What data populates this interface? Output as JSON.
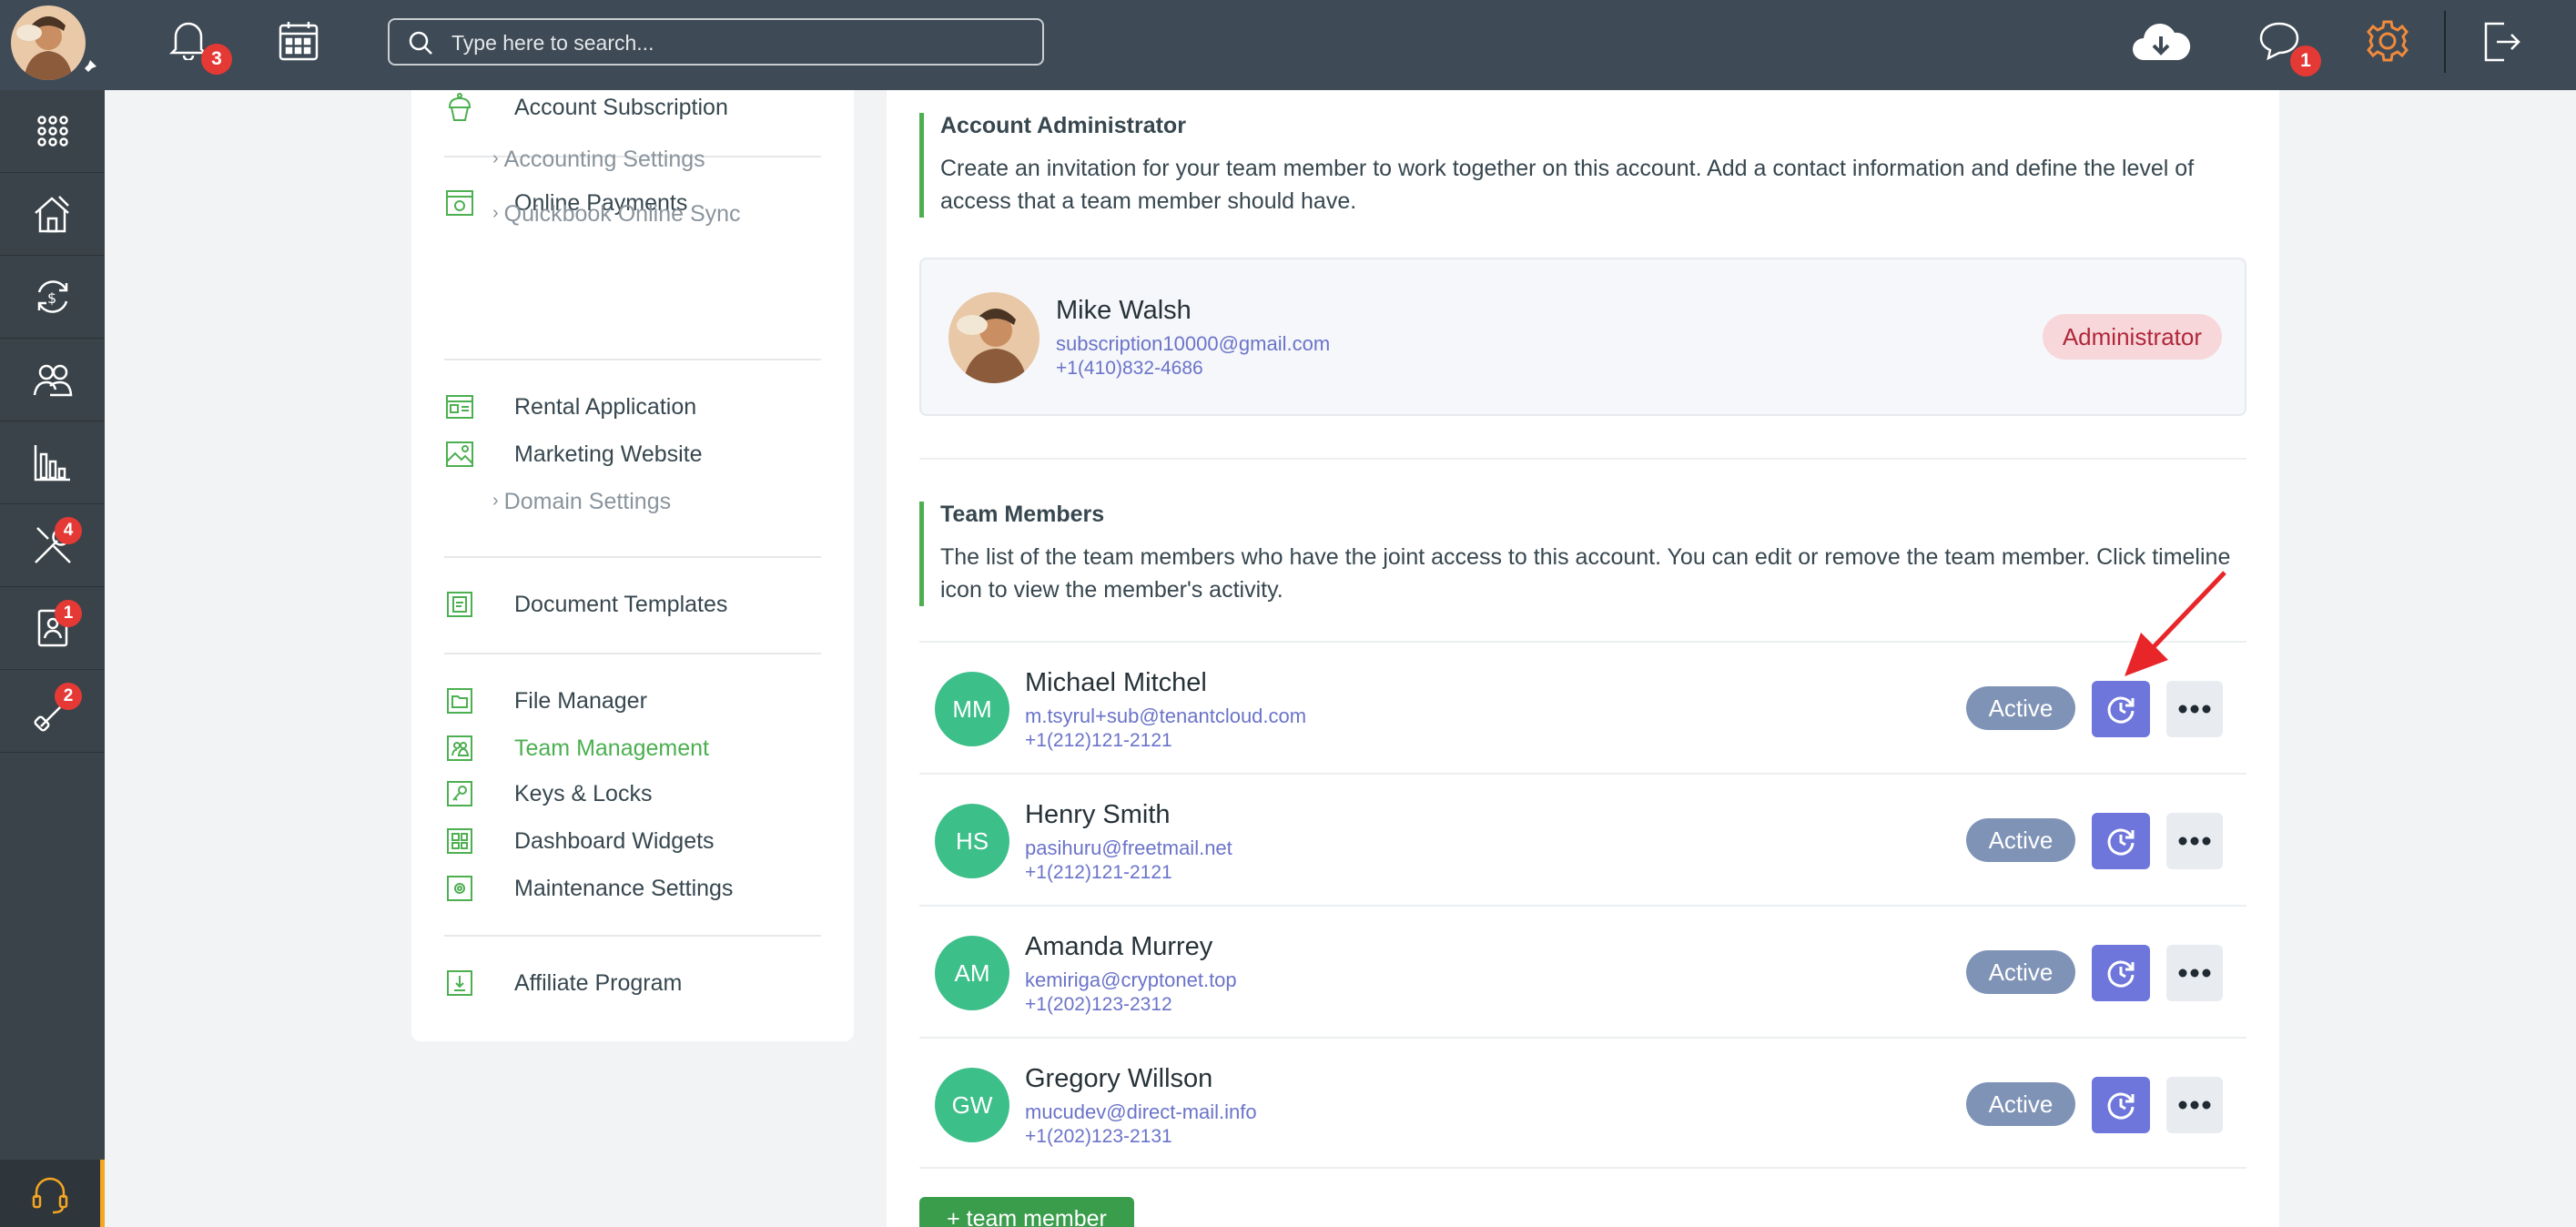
{
  "topbar": {
    "notifications_count": "3",
    "messages_count": "1",
    "search_placeholder": "Type here to search..."
  },
  "sidebar": {
    "items": [
      {
        "name": "apps",
        "icon": "grid-icon",
        "badge": ""
      },
      {
        "name": "properties",
        "icon": "house-icon",
        "badge": ""
      },
      {
        "name": "transactions",
        "icon": "money-cycle-icon",
        "badge": ""
      },
      {
        "name": "contacts",
        "icon": "people-icon",
        "badge": ""
      },
      {
        "name": "reports",
        "icon": "bar-chart-icon",
        "badge": ""
      },
      {
        "name": "maintenance",
        "icon": "tools-icon",
        "badge": "4"
      },
      {
        "name": "applications",
        "icon": "document-person-icon",
        "badge": "1"
      },
      {
        "name": "listings",
        "icon": "link-icon",
        "badge": "2"
      }
    ]
  },
  "menu": {
    "account_subscription": "Account Subscription",
    "online_payments": "Online Payments",
    "accounting_settings": "Accounting Settings",
    "quickbook_sync": "Quickbook Online Sync",
    "rental_application": "Rental Application",
    "marketing_website": "Marketing Website",
    "domain_settings": "Domain Settings",
    "document_templates": "Document Templates",
    "file_manager": "File Manager",
    "team_management": "Team Management",
    "keys_locks": "Keys & Locks",
    "dashboard_widgets": "Dashboard Widgets",
    "maintenance_settings": "Maintenance Settings",
    "affiliate_program": "Affiliate Program"
  },
  "admin_section": {
    "title": "Account Administrator",
    "description": "Create an invitation for your team member to work together on this account. Add a contact information and define the level of access that a team member should have.",
    "name": "Mike Walsh",
    "email": "subscription10000@gmail.com",
    "phone": "+1(410)832-4686",
    "role": "Administrator"
  },
  "team_section": {
    "title": "Team Members",
    "description": "The list of the team members who have the joint access to this account. You can edit or remove the team member. Click timeline icon to view the member's activity.",
    "members": [
      {
        "initials": "MM",
        "name": "Michael Mitchel",
        "email": "m.tsyrul+sub@tenantcloud.com",
        "phone": "+1(212)121-2121",
        "status": "Active"
      },
      {
        "initials": "HS",
        "name": "Henry Smith",
        "email": "pasihuru@freetmail.net",
        "phone": "+1(212)121-2121",
        "status": "Active"
      },
      {
        "initials": "AM",
        "name": "Amanda Murrey",
        "email": "kemiriga@cryptonet.top",
        "phone": "+1(202)123-2312",
        "status": "Active"
      },
      {
        "initials": "GW",
        "name": "Gregory Willson",
        "email": "mucudev@direct-mail.info",
        "phone": "+1(202)123-2131",
        "status": "Active"
      }
    ],
    "add_button": "+ team member"
  },
  "colors": {
    "topbar": "#3e4a55",
    "sidebar": "#3a4349",
    "accent_green": "#4caf50",
    "timeline_purple": "#6e76db",
    "status_blue": "#7f93b6",
    "admin_pill": "#f8d7db",
    "badge_red": "#e53935",
    "gear_orange": "#f08a3c"
  }
}
